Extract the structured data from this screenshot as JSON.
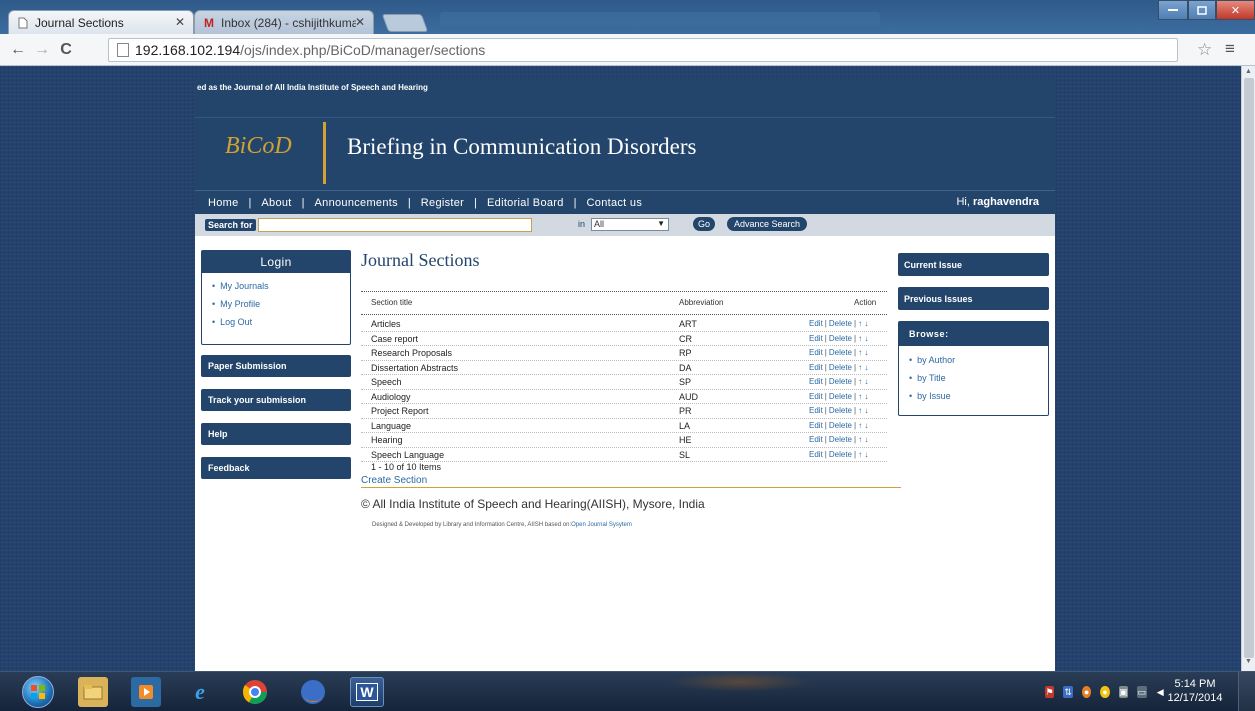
{
  "browser": {
    "tabs": [
      {
        "label": "Journal Sections",
        "icon": "page-icon"
      },
      {
        "label": "Inbox (284) - cshijithkuma",
        "icon": "gmail-icon"
      }
    ],
    "url_host": "192.168.102.194",
    "url_path": "/ojs/index.php/BiCoD/manager/sections"
  },
  "site": {
    "tagline": "ed as the Journal of All India Institute of Speech and Hearing",
    "logo_text": "BiCoD",
    "title": "Briefing in Communication Disorders",
    "nav": [
      "Home",
      "About",
      "Announcements",
      "Register",
      "Editorial Board",
      "Contact us"
    ],
    "nav_separator": "|",
    "greeting_prefix": "Hi, ",
    "username": "raghavendra",
    "search": {
      "label": "Search  for",
      "value": "",
      "in_label": "in",
      "scope_selected": "All",
      "go_label": "Go",
      "advanced_label": "Advance Search"
    }
  },
  "left_sidebar": {
    "login_title": "Login",
    "links": [
      "My Journals",
      "My Profile",
      "Log Out"
    ],
    "buttons": [
      "Paper Submission",
      "Track your submission",
      "Help",
      "Feedback"
    ]
  },
  "main": {
    "heading": "Journal Sections",
    "columns": [
      "Section title",
      "Abbreviation",
      "Action"
    ],
    "rows": [
      {
        "title": "Articles",
        "abbr": "ART"
      },
      {
        "title": "Case report",
        "abbr": "CR"
      },
      {
        "title": "Research Proposals",
        "abbr": "RP"
      },
      {
        "title": "Dissertation Abstracts",
        "abbr": "DA"
      },
      {
        "title": "Speech",
        "abbr": "SP"
      },
      {
        "title": "Audiology",
        "abbr": "AUD"
      },
      {
        "title": "Project Report",
        "abbr": "PR"
      },
      {
        "title": "Language",
        "abbr": "LA"
      },
      {
        "title": "Hearing",
        "abbr": "HE"
      },
      {
        "title": "Speech Language",
        "abbr": "SL"
      }
    ],
    "action_edit": "Edit",
    "action_delete": "Delete",
    "action_up": "↑",
    "action_down": "↓",
    "item_count": "1 - 10 of 10 Items",
    "create_link": "Create Section",
    "footer_copyright": "© All India Institute of Speech and Hearing(AIISH), Mysore, India",
    "footer_credit": "Designed & Developed by Library and Information Centre, AIISH based on:",
    "footer_credit_link": "Open Journal Sysytem"
  },
  "right_sidebar": {
    "buttons": [
      "Current Issue",
      "Previous Issues"
    ],
    "browse_title": "Browse:",
    "browse_links": [
      "by Author",
      "by Title",
      "by Issue"
    ]
  },
  "taskbar": {
    "time": "5:14 PM",
    "date": "12/17/2014"
  },
  "colors": {
    "brand_navy": "#23456b",
    "brand_gold": "#d1a232",
    "link_blue": "#2b6aa3"
  }
}
